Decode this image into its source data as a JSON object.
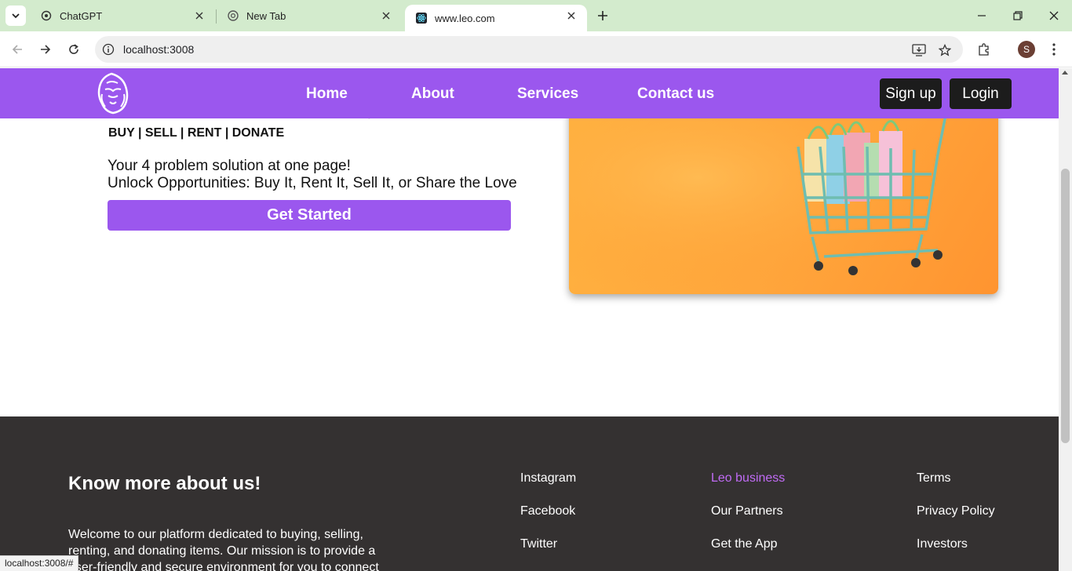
{
  "browser": {
    "tabs": [
      {
        "title": "ChatGPT",
        "icon": "chatgpt-icon"
      },
      {
        "title": "New Tab",
        "icon": "chrome-icon"
      },
      {
        "title": "www.leo.com",
        "icon": "react-icon",
        "active": true
      }
    ],
    "url": "localhost:3008",
    "profile_initial": "S",
    "status_url": "localhost:3008/#"
  },
  "site": {
    "nav": {
      "links": [
        "Home",
        "About",
        "Services",
        "Contact us"
      ],
      "signup_label": "Sign up",
      "login_label": "Login"
    },
    "hero": {
      "tagline": "BUY | SELL | RENT | DONATE",
      "line1": "Your 4 problem solution at one page!",
      "line2": "Unlock Opportunities: Buy It, Rent It, Sell It, or Share the Love",
      "cta_label": "Get Started"
    },
    "footer": {
      "title": "Know more about us!",
      "text": "Welcome to our platform dedicated to buying, selling, renting, and donating items. Our mission is to provide a user-friendly and secure environment for you to connect",
      "col1": [
        "Instagram",
        "Facebook",
        "Twitter"
      ],
      "col2": [
        "Leo business",
        "Our Partners",
        "Get the App"
      ],
      "col3": [
        "Terms",
        "Privacy Policy",
        "Investors"
      ]
    }
  },
  "colors": {
    "brand_purple": "#9b57ee",
    "footer_bg": "#343131",
    "accent_link": "#c06bf5"
  }
}
